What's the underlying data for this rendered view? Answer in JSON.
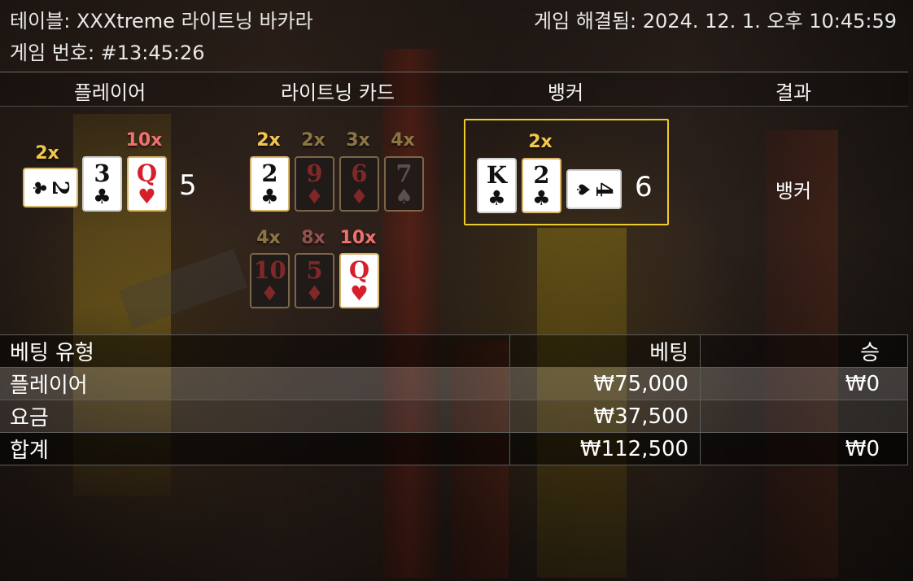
{
  "header": {
    "table_label": "테이블: XXXtreme 라이트닝 바카라",
    "resolved_label": "게임 해결됨: 2024. 12. 1. 오후 10:45:59",
    "game_label": "게임 번호: #13:45:26"
  },
  "columns": {
    "player": "플레이어",
    "lightning": "라이트닝 카드",
    "banker": "뱅커",
    "result": "결과"
  },
  "player": {
    "cards": [
      {
        "rank": "2",
        "suit": "♣",
        "multiplier": "2x"
      },
      {
        "rank": "3",
        "suit": "♣",
        "multiplier": ""
      },
      {
        "rank": "Q",
        "suit": "♥",
        "multiplier": "10x"
      }
    ],
    "score": "5"
  },
  "lightning": {
    "cards": [
      {
        "rank": "2",
        "suit": "♣",
        "multiplier": "2x"
      },
      {
        "rank": "9",
        "suit": "♦",
        "multiplier": "2x"
      },
      {
        "rank": "6",
        "suit": "♦",
        "multiplier": "3x"
      },
      {
        "rank": "7",
        "suit": "♠",
        "multiplier": "4x"
      },
      {
        "rank": "10",
        "suit": "♦",
        "multiplier": "4x"
      },
      {
        "rank": "5",
        "suit": "♦",
        "multiplier": "8x"
      },
      {
        "rank": "Q",
        "suit": "♥",
        "multiplier": "10x"
      }
    ]
  },
  "banker": {
    "cards": [
      {
        "rank": "K",
        "suit": "♣",
        "multiplier": ""
      },
      {
        "rank": "2",
        "suit": "♣",
        "multiplier": "2x"
      },
      {
        "rank": "4",
        "suit": "♠",
        "multiplier": ""
      }
    ],
    "score": "6"
  },
  "result": "뱅커",
  "bets": {
    "headers": {
      "type": "베팅 유형",
      "bet": "베팅",
      "win": "승"
    },
    "rows": [
      {
        "type": "플레이어",
        "bet": "₩75,000",
        "win": "₩0"
      },
      {
        "type": "요금",
        "bet": "₩37,500",
        "win": ""
      },
      {
        "type": "합계",
        "bet": "₩112,500",
        "win": "₩0"
      }
    ]
  },
  "colors": {
    "highlight_border": "#f0cc28",
    "multiplier_gold": "#f3c64c",
    "multiplier_red": "#f07070",
    "suit_red": "#d61f2c"
  }
}
